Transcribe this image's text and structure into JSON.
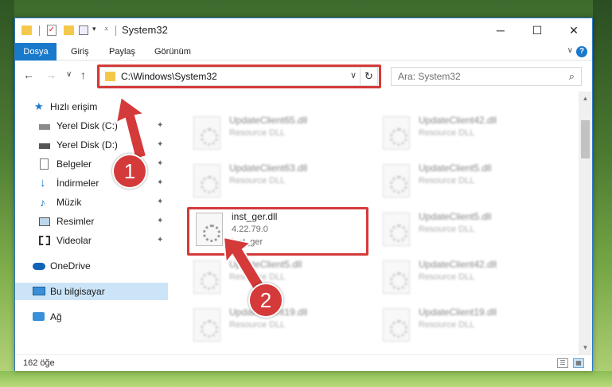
{
  "window": {
    "title": "System32",
    "minimize": "─",
    "maximize": "☐",
    "close": "✕"
  },
  "ribbon": {
    "tabs": [
      "Dosya",
      "Giriş",
      "Paylaş",
      "Görünüm"
    ],
    "expand": "∨",
    "help": "?"
  },
  "nav": {
    "back": "←",
    "forward": "→",
    "recent": "∨",
    "up": "↑",
    "address": "C:\\Windows\\System32",
    "address_dropdown": "∨",
    "refresh": "↻",
    "search_placeholder": "Ara: System32",
    "search_icon": "⌕"
  },
  "sidebar": {
    "items": [
      {
        "label": "Hızlı erişim",
        "icon": "star-icon",
        "color": "#1979ca"
      },
      {
        "label": "Yerel Disk (C:)",
        "icon": "drive-icon",
        "pinned": true
      },
      {
        "label": "Yerel Disk (D:)",
        "icon": "drive-icon",
        "pinned": true
      },
      {
        "label": "Belgeler",
        "icon": "documents-icon",
        "pinned": true
      },
      {
        "label": "İndirmeler",
        "icon": "download-icon",
        "pinned": true
      },
      {
        "label": "Müzik",
        "icon": "music-icon",
        "pinned": true
      },
      {
        "label": "Resimler",
        "icon": "pictures-icon",
        "pinned": true
      },
      {
        "label": "Videolar",
        "icon": "videos-icon",
        "pinned": true
      },
      {
        "label": "OneDrive",
        "icon": "cloud-icon"
      },
      {
        "label": "Bu bilgisayar",
        "icon": "computer-icon",
        "selected": true
      },
      {
        "label": "Ağ",
        "icon": "network-icon"
      }
    ],
    "pin_glyph": "✦"
  },
  "files": [
    {
      "name": "UpdateClient65.dll",
      "line2": "Resource DLL",
      "line3": ""
    },
    {
      "name": "UpdateClient42.dll",
      "line2": "Resource DLL",
      "line3": ""
    },
    {
      "name": "UpdateClient63.dll",
      "line2": "Resource DLL",
      "line3": ""
    },
    {
      "name": "UpdateClient5.dll",
      "line2": "Resource DLL",
      "line3": ""
    },
    {
      "name": "inst_ger.dll",
      "line2": "4.22.79.0",
      "line3": "inst_ger"
    },
    {
      "name": "UpdateClient5.dll",
      "line2": "Resource DLL",
      "line3": ""
    },
    {
      "name": "UpdateClient5.dll",
      "line2": "Resource DLL",
      "line3": ""
    },
    {
      "name": "UpdateClient42.dll",
      "line2": "Resource DLL",
      "line3": ""
    },
    {
      "name": "UpdateClient19.dll",
      "line2": "Resource DLL",
      "line3": ""
    },
    {
      "name": "UpdateClient19.dll",
      "line2": "Resource DLL",
      "line3": ""
    }
  ],
  "status": {
    "count": "162 öğe"
  },
  "callouts": [
    {
      "number": "1"
    },
    {
      "number": "2"
    }
  ],
  "colors": {
    "accent": "#1979ca",
    "highlight": "#d43a3a",
    "selected": "#cce4f7"
  }
}
